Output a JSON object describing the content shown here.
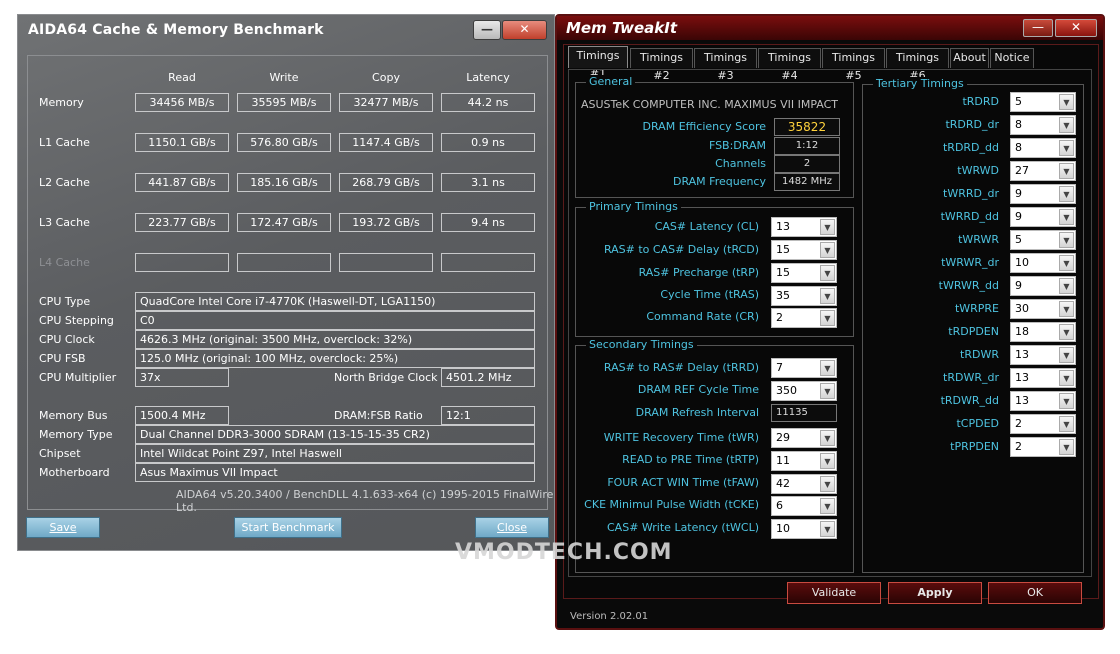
{
  "aida": {
    "title": "AIDA64 Cache & Memory Benchmark",
    "min_glyph": "—",
    "close_glyph": "✕",
    "headers": [
      "Read",
      "Write",
      "Copy",
      "Latency"
    ],
    "bench_rows": [
      {
        "label": "Memory",
        "cells": [
          "34456 MB/s",
          "35595 MB/s",
          "32477 MB/s",
          "44.2 ns"
        ]
      },
      {
        "label": "L1 Cache",
        "cells": [
          "1150.1 GB/s",
          "576.80 GB/s",
          "1147.4 GB/s",
          "0.9 ns"
        ]
      },
      {
        "label": "L2 Cache",
        "cells": [
          "441.87 GB/s",
          "185.16 GB/s",
          "268.79 GB/s",
          "3.1 ns"
        ]
      },
      {
        "label": "L3 Cache",
        "cells": [
          "223.77 GB/s",
          "172.47 GB/s",
          "193.72 GB/s",
          "9.4 ns"
        ]
      },
      {
        "label": "L4 Cache",
        "cells": [
          "",
          "",
          "",
          ""
        ]
      }
    ],
    "cpu": {
      "type_label": "CPU Type",
      "type": "QuadCore Intel Core i7-4770K  (Haswell-DT, LGA1150)",
      "stepping_label": "CPU Stepping",
      "stepping": "C0",
      "clock_label": "CPU Clock",
      "clock": "4626.3 MHz  (original: 3500 MHz, overclock: 32%)",
      "fsb_label": "CPU FSB",
      "fsb": "125.0 MHz  (original: 100 MHz, overclock: 25%)",
      "mult_label": "CPU Multiplier",
      "mult": "37x",
      "nb_label": "North Bridge Clock",
      "nb": "4501.2 MHz"
    },
    "mem": {
      "bus_label": "Memory Bus",
      "bus": "1500.4 MHz",
      "ratio_label": "DRAM:FSB Ratio",
      "ratio": "12:1",
      "type_label": "Memory Type",
      "type": "Dual Channel DDR3-3000 SDRAM  (13-15-15-35 CR2)",
      "chipset_label": "Chipset",
      "chipset": "Intel Wildcat Point Z97, Intel Haswell",
      "mobo_label": "Motherboard",
      "mobo": "Asus Maximus VII Impact"
    },
    "footer": "AIDA64 v5.20.3400 / BenchDLL 4.1.633-x64  (c) 1995-2015 FinalWire Ltd.",
    "save_label": "Save",
    "start_label": "Start Benchmark",
    "close_label": "Close"
  },
  "memtweak": {
    "title": "Mem TweakIt",
    "min_glyph": "—",
    "close_glyph": "✕",
    "tabs": [
      "Timings #1",
      "Timings #2",
      "Timings #3",
      "Timings #4",
      "Timings #5",
      "Timings #6",
      "About",
      "Notice"
    ],
    "general": {
      "title": "General",
      "board": "ASUSTeK COMPUTER INC. MAXIMUS VII IMPACT",
      "eff_label": "DRAM Efficiency Score",
      "eff": "35822",
      "fsb_label": "FSB:DRAM",
      "fsb": "1:12",
      "ch_label": "Channels",
      "ch": "2",
      "freq_label": "DRAM Frequency",
      "freq": "1482 MHz"
    },
    "primary": {
      "title": "Primary Timings",
      "items": [
        {
          "label": "CAS# Latency (CL)",
          "value": "13"
        },
        {
          "label": "RAS# to CAS# Delay (tRCD)",
          "value": "15"
        },
        {
          "label": "RAS# Precharge (tRP)",
          "value": "15"
        },
        {
          "label": "Cycle Time (tRAS)",
          "value": "35"
        },
        {
          "label": "Command Rate (CR)",
          "value": "2"
        }
      ]
    },
    "secondary": {
      "title": "Secondary Timings",
      "rrd_label": "RAS# to RAS# Delay (tRRD)",
      "rrd": "7",
      "ref_label": "DRAM REF Cycle Time",
      "ref": "350",
      "refi_label": "DRAM Refresh Interval",
      "refi": "11135",
      "items": [
        {
          "label": "WRITE Recovery Time (tWR)",
          "value": "29"
        },
        {
          "label": "READ to PRE Time (tRTP)",
          "value": "11"
        },
        {
          "label": "FOUR ACT WIN Time (tFAW)",
          "value": "42"
        },
        {
          "label": "CKE Minimul Pulse Width (tCKE)",
          "value": "6"
        },
        {
          "label": "CAS# Write Latency (tWCL)",
          "value": "10"
        }
      ]
    },
    "tertiary": {
      "title": "Tertiary Timings",
      "items": [
        {
          "label": "tRDRD",
          "value": "5"
        },
        {
          "label": "tRDRD_dr",
          "value": "8"
        },
        {
          "label": "tRDRD_dd",
          "value": "8"
        },
        {
          "label": "tWRWD",
          "value": "27"
        },
        {
          "label": "tWRRD_dr",
          "value": "9"
        },
        {
          "label": "tWRRD_dd",
          "value": "9"
        },
        {
          "label": "tWRWR",
          "value": "5"
        },
        {
          "label": "tWRWR_dr",
          "value": "10"
        },
        {
          "label": "tWRWR_dd",
          "value": "9"
        },
        {
          "label": "tWRPRE",
          "value": "30"
        },
        {
          "label": "tRDPDEN",
          "value": "18"
        },
        {
          "label": "tRDWR",
          "value": "13"
        },
        {
          "label": "tRDWR_dr",
          "value": "13"
        },
        {
          "label": "tRDWR_dd",
          "value": "13"
        },
        {
          "label": "tCPDED",
          "value": "2"
        },
        {
          "label": "tPRPDEN",
          "value": "2"
        }
      ]
    },
    "validate_label": "Validate",
    "apply_label": "Apply",
    "ok_label": "OK",
    "version": "Version 2.02.01",
    "dropdown_glyph": "▼"
  },
  "watermark": "VMODTECH.COM"
}
